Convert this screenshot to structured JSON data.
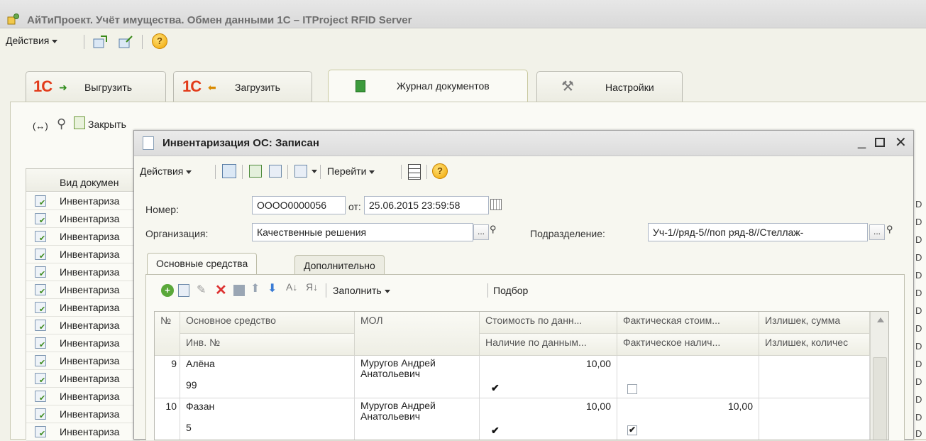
{
  "window": {
    "title": "АйТиПроект. Учёт имущества. Обмен данными 1С – ITProject RFID Server"
  },
  "main_toolbar": {
    "actions_label": "Действия",
    "help_label": "?"
  },
  "tabs": [
    {
      "label": "Выгрузить",
      "logo": "1С"
    },
    {
      "label": "Загрузить",
      "logo": "1С"
    },
    {
      "label": "Журнал документов"
    },
    {
      "label": "Настройки"
    }
  ],
  "journal_toolbar": {
    "expand_label": "(↔)",
    "close_label": "Закрыть"
  },
  "doc_list": {
    "header": "Вид докумен",
    "rows": [
      "Инвентариза",
      "Инвентариза",
      "Инвентариза",
      "Инвентариза",
      "Инвентариза",
      "Инвентариза",
      "Инвентариза",
      "Инвентариза",
      "Инвентариза",
      "Инвентариза",
      "Инвентариза",
      "Инвентариза",
      "Инвентариза",
      "Инвентариза"
    ]
  },
  "right_strip": [
    "D",
    "D",
    "D",
    "D",
    "D",
    "D",
    "D",
    "D",
    "D",
    "D",
    "D",
    "D",
    "D",
    "D"
  ],
  "dialog": {
    "title": "Инвентаризация ОС: Записан",
    "toolbar": {
      "actions_label": "Действия",
      "goto_label": "Перейти",
      "help_label": "?"
    },
    "number_label": "Номер:",
    "number_value": "ОООО0000056",
    "date_label": "от:",
    "date_value": "25.06.2015 23:59:58",
    "org_label": "Организация:",
    "org_value": "Качественные решения",
    "dept_label": "Подразделение:",
    "dept_value": "Уч-1//ряд-5//поп ряд-8//Стеллаж-",
    "select_btn": "...",
    "inner_tabs": [
      "Основные средства",
      "Дополнительно"
    ],
    "grid_toolbar": {
      "fill_label": "Заполнить",
      "pick_label": "Подбор"
    },
    "grid": {
      "headers_top": [
        "№",
        "Основное средство",
        "МОЛ",
        "Стоимость по данн...",
        "Фактическая стоим...",
        "Излишек, сумма"
      ],
      "headers_bottom": [
        "Инв. №",
        "Наличие по данным...",
        "Фактическое налич...",
        "Излишек, количес"
      ],
      "rows": [
        {
          "n": "9",
          "asset": "Алёна",
          "inv": "99",
          "mol": "Муругов Андрей Анатольевич",
          "cost": "10,00",
          "fact_cost": "",
          "present_data": true,
          "present_fact": false
        },
        {
          "n": "10",
          "asset": "Фазан",
          "inv": "5",
          "mol": "Муругов Андрей Анатольевич",
          "cost": "10,00",
          "fact_cost": "10,00",
          "present_data": true,
          "present_fact": true
        }
      ]
    }
  }
}
